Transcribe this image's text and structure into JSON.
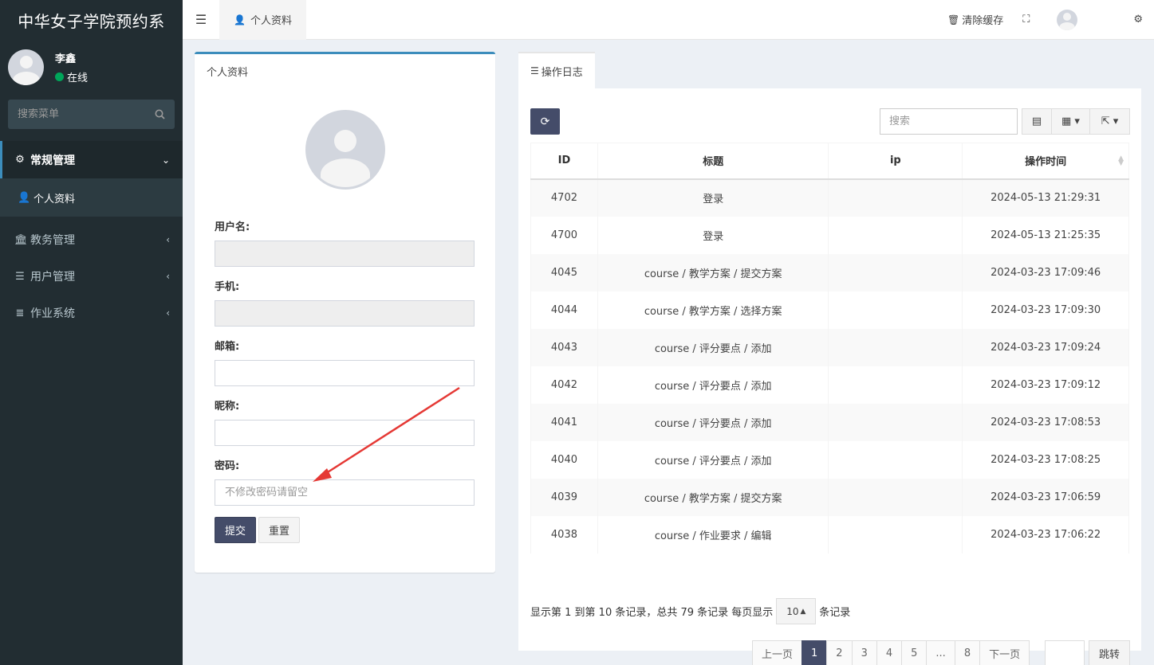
{
  "app": {
    "title": "中华女子学院预约系"
  },
  "user": {
    "name": "李鑫",
    "status": "在线"
  },
  "sidebar": {
    "search_placeholder": "搜索菜单",
    "items": [
      {
        "label": "常规管理",
        "icon": "cogs-icon",
        "expanded": true
      },
      {
        "label": "个人资料",
        "icon": "user-icon"
      },
      {
        "label": "教务管理",
        "icon": "bank-icon"
      },
      {
        "label": "用户管理",
        "icon": "list-icon"
      },
      {
        "label": "作业系统",
        "icon": "database-icon"
      }
    ]
  },
  "topbar": {
    "tab_label": "个人资料",
    "clear_cache": "清除缓存"
  },
  "profile": {
    "title": "个人资料",
    "username_label": "用户名:",
    "username_value": "",
    "mobile_label": "手机:",
    "mobile_value": "",
    "email_label": "邮箱:",
    "email_value": "",
    "nickname_label": "昵称:",
    "nickname_value": "",
    "password_label": "密码:",
    "password_placeholder": "不修改密码请留空",
    "submit_label": "提交",
    "reset_label": "重置"
  },
  "log": {
    "tab_label": "操作日志",
    "search_placeholder": "搜索",
    "columns": [
      "ID",
      "标题",
      "ip",
      "操作时间"
    ],
    "rows": [
      {
        "id": "4702",
        "title": "登录",
        "ip": "",
        "time": "2024-05-13 21:29:31"
      },
      {
        "id": "4700",
        "title": "登录",
        "ip": "",
        "time": "2024-05-13 21:25:35"
      },
      {
        "id": "4045",
        "title": "course / 教学方案 / 提交方案",
        "ip": "",
        "time": "2024-03-23 17:09:46"
      },
      {
        "id": "4044",
        "title": "course / 教学方案 / 选择方案",
        "ip": "",
        "time": "2024-03-23 17:09:30"
      },
      {
        "id": "4043",
        "title": "course / 评分要点 / 添加",
        "ip": "",
        "time": "2024-03-23 17:09:24"
      },
      {
        "id": "4042",
        "title": "course / 评分要点 / 添加",
        "ip": "",
        "time": "2024-03-23 17:09:12"
      },
      {
        "id": "4041",
        "title": "course / 评分要点 / 添加",
        "ip": "",
        "time": "2024-03-23 17:08:53"
      },
      {
        "id": "4040",
        "title": "course / 评分要点 / 添加",
        "ip": "",
        "time": "2024-03-23 17:08:25"
      },
      {
        "id": "4039",
        "title": "course / 教学方案 / 提交方案",
        "ip": "",
        "time": "2024-03-23 17:06:59"
      },
      {
        "id": "4038",
        "title": "course / 作业要求 / 编辑",
        "ip": "",
        "time": "2024-03-23 17:06:22"
      }
    ],
    "pagination_info": "显示第 1 到第 10 条记录，总共 79 条记录 每页显示",
    "page_size": "10",
    "page_size_suffix": "条记录",
    "prev_label": "上一页",
    "next_label": "下一页",
    "pages": [
      "1",
      "2",
      "3",
      "4",
      "5",
      "...",
      "8"
    ],
    "current_page": "1",
    "jump_label": "跳转"
  },
  "colors": {
    "sidebar_bg": "#222d32",
    "primary_btn": "#444c69",
    "status_online": "#00a65a",
    "annotation_arrow": "#e53935"
  }
}
